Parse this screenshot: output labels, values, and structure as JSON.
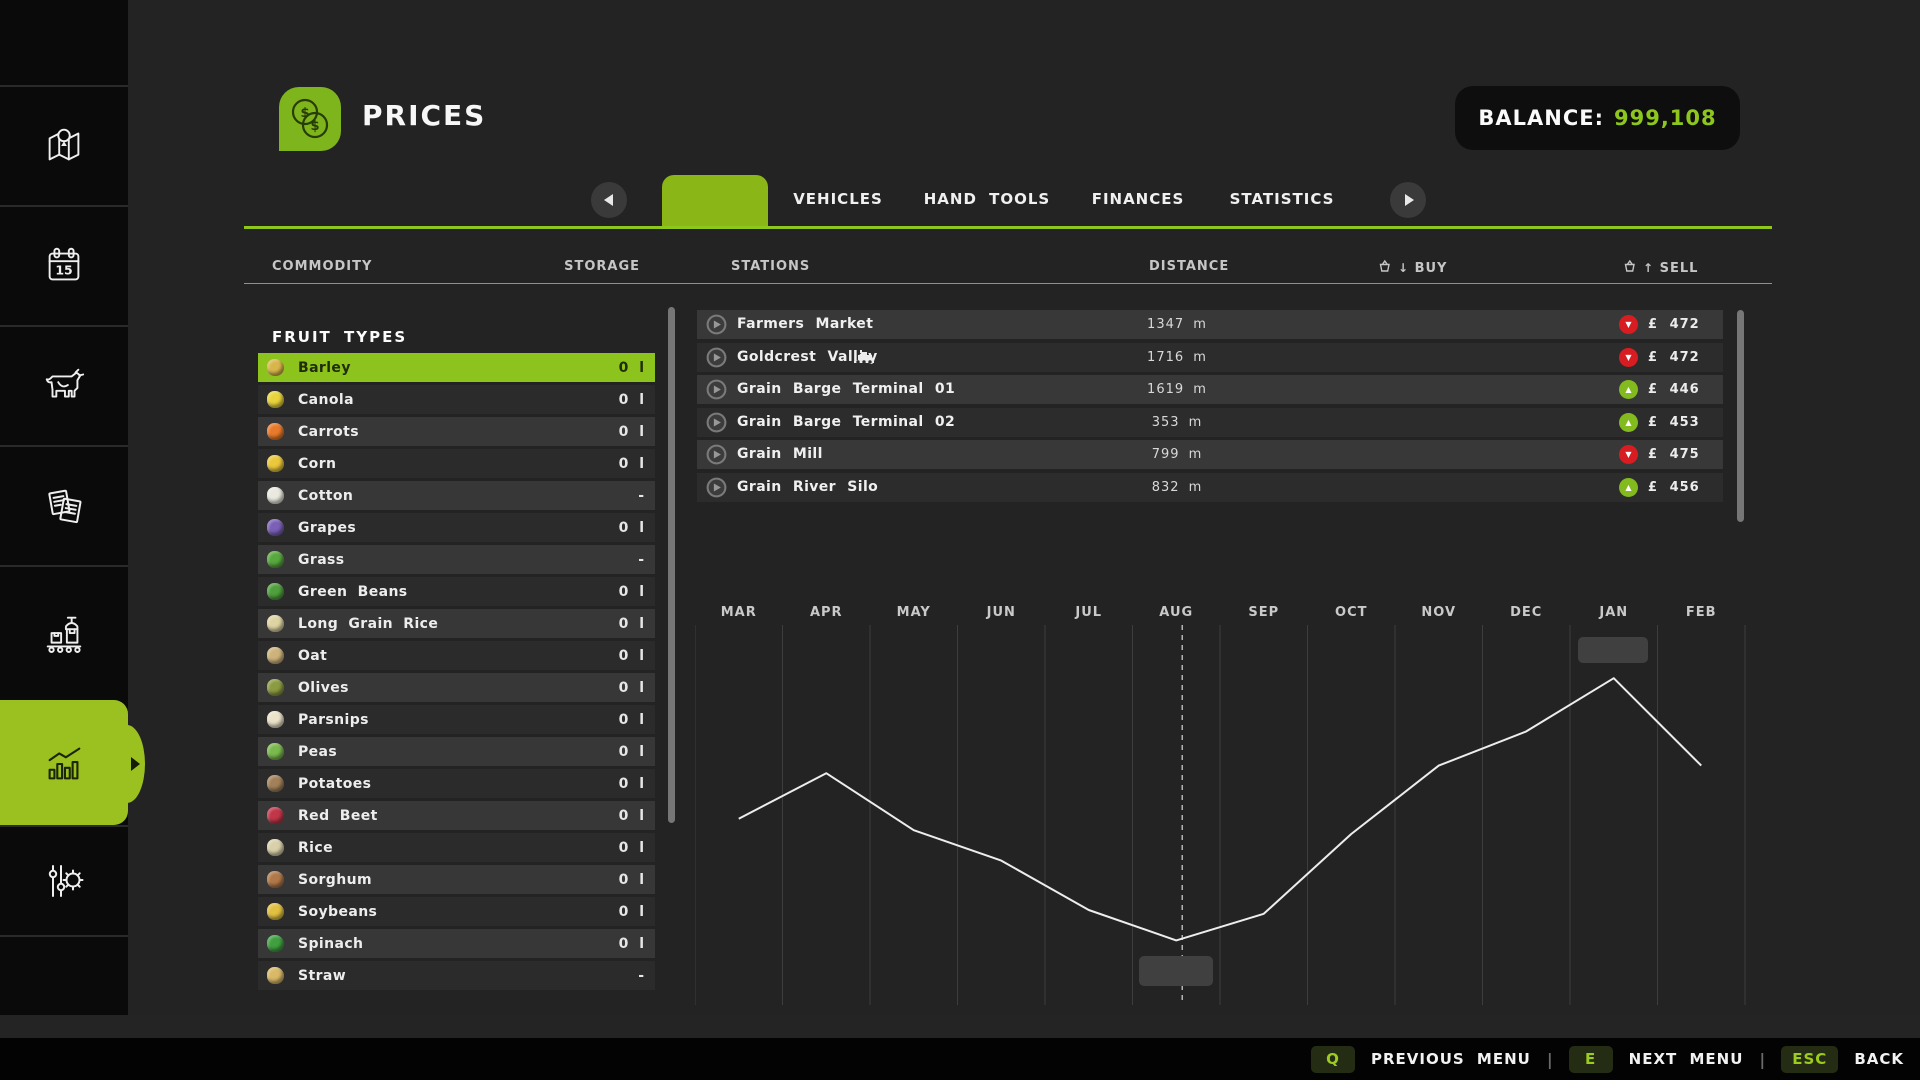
{
  "colors": {
    "accent": "#8dc71e",
    "sidebar_active": "#9bc120",
    "tab_active": "#8ab617",
    "balance_value": "#8dc71e",
    "sell_up_badge": "#83ba1e",
    "sell_down_badge": "#d81d22",
    "row_light": "#373737",
    "row_dark": "#2b2b2b",
    "background": "#232323",
    "sidebar_background": "#0a0a0a"
  },
  "sidebar": {
    "items": [
      {
        "id": "map",
        "icon": "map-icon",
        "active": false
      },
      {
        "id": "calendar",
        "icon": "calendar-icon",
        "active": false
      },
      {
        "id": "animals",
        "icon": "animal-icon",
        "active": false
      },
      {
        "id": "contracts",
        "icon": "contracts-icon",
        "active": false
      },
      {
        "id": "production",
        "icon": "production-icon",
        "active": false
      },
      {
        "id": "prices",
        "icon": "prices-chart-icon",
        "active": true
      },
      {
        "id": "settings",
        "icon": "settings-icon",
        "active": false
      }
    ]
  },
  "header": {
    "title": "PRICES",
    "balance_label": "BALANCE:",
    "balance_value": "999,108"
  },
  "tabs": {
    "labels": [
      "VEHICLES",
      "HAND TOOLS",
      "FINANCES",
      "STATISTICS"
    ]
  },
  "columns": {
    "commodity": "COMMODITY",
    "storage": "STORAGE",
    "stations": "STATIONS",
    "distance": "DISTANCE",
    "buy": "BUY",
    "sell": "SELL"
  },
  "fruits": {
    "title": "FRUIT TYPES",
    "items": [
      {
        "name": "Barley",
        "storage": "0 l",
        "selected": true,
        "color": "#d9b64b"
      },
      {
        "name": "Canola",
        "storage": "0 l",
        "selected": false,
        "color": "#e8d33c"
      },
      {
        "name": "Carrots",
        "storage": "0 l",
        "selected": false,
        "color": "#e87a2b"
      },
      {
        "name": "Corn",
        "storage": "0 l",
        "selected": false,
        "color": "#eac73b"
      },
      {
        "name": "Cotton",
        "storage": "-",
        "selected": false,
        "color": "#e9e9e0"
      },
      {
        "name": "Grapes",
        "storage": "0 l",
        "selected": false,
        "color": "#7a60b6"
      },
      {
        "name": "Grass",
        "storage": "-",
        "selected": false,
        "color": "#58a83e"
      },
      {
        "name": "Green Beans",
        "storage": "0 l",
        "selected": false,
        "color": "#4f9f3d"
      },
      {
        "name": "Long Grain Rice",
        "storage": "0 l",
        "selected": false,
        "color": "#ded4a2"
      },
      {
        "name": "Oat",
        "storage": "0 l",
        "selected": false,
        "color": "#cdb37b"
      },
      {
        "name": "Olives",
        "storage": "0 l",
        "selected": false,
        "color": "#8b9b41"
      },
      {
        "name": "Parsnips",
        "storage": "0 l",
        "selected": false,
        "color": "#eae2c9"
      },
      {
        "name": "Peas",
        "storage": "0 l",
        "selected": false,
        "color": "#7ab94d"
      },
      {
        "name": "Potatoes",
        "storage": "0 l",
        "selected": false,
        "color": "#a28159"
      },
      {
        "name": "Red Beet",
        "storage": "0 l",
        "selected": false,
        "color": "#c13649"
      },
      {
        "name": "Rice",
        "storage": "0 l",
        "selected": false,
        "color": "#d9d0aa"
      },
      {
        "name": "Sorghum",
        "storage": "0 l",
        "selected": false,
        "color": "#b17949"
      },
      {
        "name": "Soybeans",
        "storage": "0 l",
        "selected": false,
        "color": "#e1c141"
      },
      {
        "name": "Spinach",
        "storage": "0 l",
        "selected": false,
        "color": "#40a040"
      },
      {
        "name": "Straw",
        "storage": "-",
        "selected": false,
        "color": "#d9b967"
      }
    ]
  },
  "stations": {
    "items": [
      {
        "name": "Farmers Market",
        "train": false,
        "distance": "1347 m",
        "sell_price": "£ 472",
        "trend": "down"
      },
      {
        "name": "Goldcrest Valley",
        "train": true,
        "distance": "1716 m",
        "sell_price": "£ 472",
        "trend": "down"
      },
      {
        "name": "Grain Barge Terminal 01",
        "train": false,
        "distance": "1619 m",
        "sell_price": "£ 446",
        "trend": "up"
      },
      {
        "name": "Grain Barge Terminal 02",
        "train": false,
        "distance": "353 m",
        "sell_price": "£ 453",
        "trend": "up"
      },
      {
        "name": "Grain Mill",
        "train": false,
        "distance": "799 m",
        "sell_price": "£ 475",
        "trend": "down"
      },
      {
        "name": "Grain River Silo",
        "train": false,
        "distance": "832 m",
        "sell_price": "£ 456",
        "trend": "up"
      }
    ]
  },
  "chart_data": {
    "type": "line",
    "title": "",
    "x": [
      "MAR",
      "APR",
      "MAY",
      "JUN",
      "JUL",
      "AUG",
      "SEP",
      "OCT",
      "NOV",
      "DEC",
      "JAN",
      "FEB"
    ],
    "values": [
      49,
      61,
      46,
      38,
      25,
      17,
      24,
      45,
      63,
      72,
      86,
      63
    ],
    "ylabel": "",
    "ylim": [
      0,
      100
    ],
    "y_axis_labels_shown": false,
    "grid": true,
    "legend": false,
    "current_month_marker": "AUG",
    "min_value_month": "AUG",
    "max_value_month": "JAN"
  },
  "footer": {
    "hints": [
      {
        "key": "Q",
        "label": "PREVIOUS MENU"
      },
      {
        "key": "E",
        "label": "NEXT MENU"
      },
      {
        "key": "ESC",
        "label": "BACK"
      }
    ]
  }
}
